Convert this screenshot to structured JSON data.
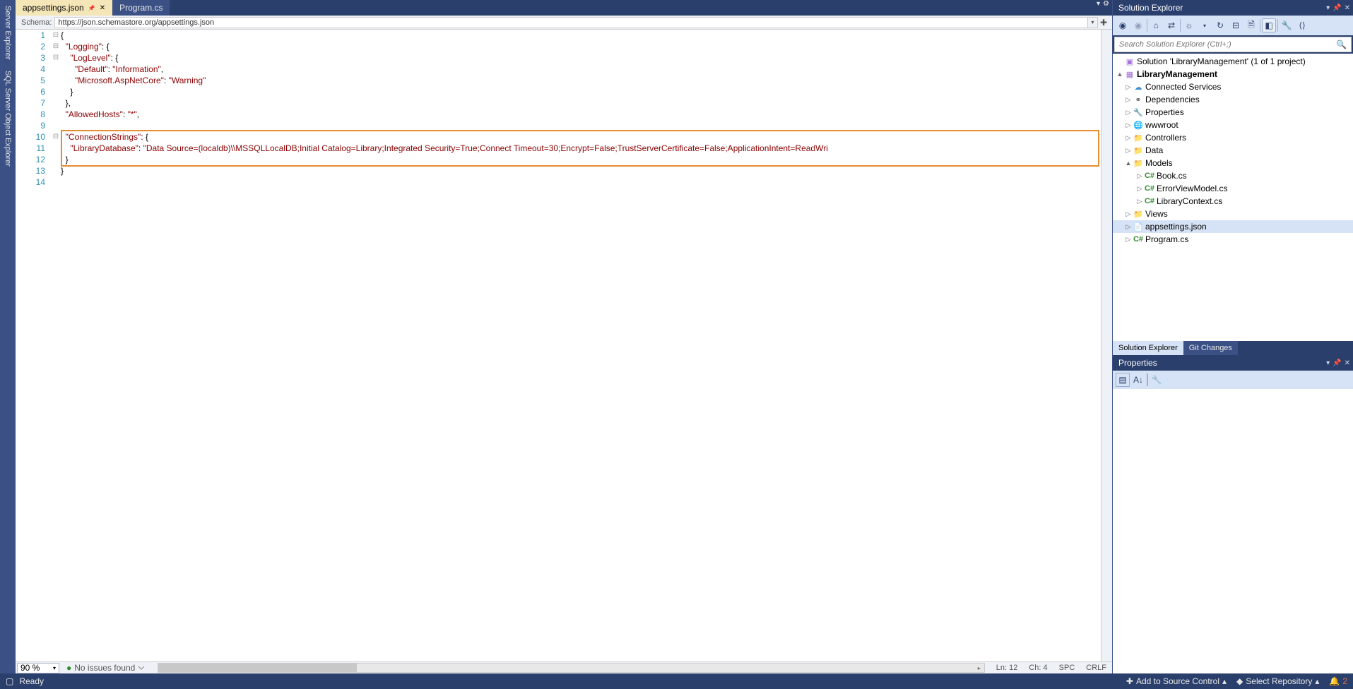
{
  "left_sidebar": {
    "tabs": [
      "Server Explorer",
      "SQL Server Object Explorer"
    ]
  },
  "editor": {
    "tabs": [
      {
        "label": "appsettings.json",
        "active": true
      },
      {
        "label": "Program.cs",
        "active": false
      }
    ],
    "schema_label": "Schema:",
    "schema_url": "https://json.schemastore.org/appsettings.json",
    "code": {
      "lines": [
        {
          "n": 1,
          "fold": "⊟",
          "segments": [
            {
              "t": "{",
              "c": "p"
            }
          ]
        },
        {
          "n": 2,
          "fold": "⊟",
          "segments": [
            {
              "t": "  ",
              "c": "p"
            },
            {
              "t": "\"Logging\"",
              "c": "k"
            },
            {
              "t": ": {",
              "c": "p"
            }
          ]
        },
        {
          "n": 3,
          "fold": "⊟",
          "segments": [
            {
              "t": "    ",
              "c": "p"
            },
            {
              "t": "\"LogLevel\"",
              "c": "k"
            },
            {
              "t": ": {",
              "c": "p"
            }
          ]
        },
        {
          "n": 4,
          "fold": "",
          "segments": [
            {
              "t": "      ",
              "c": "p"
            },
            {
              "t": "\"Default\"",
              "c": "k"
            },
            {
              "t": ": ",
              "c": "p"
            },
            {
              "t": "\"Information\"",
              "c": "v"
            },
            {
              "t": ",",
              "c": "p"
            }
          ]
        },
        {
          "n": 5,
          "fold": "",
          "segments": [
            {
              "t": "      ",
              "c": "p"
            },
            {
              "t": "\"Microsoft.AspNetCore\"",
              "c": "k"
            },
            {
              "t": ": ",
              "c": "p"
            },
            {
              "t": "\"Warning\"",
              "c": "v"
            }
          ]
        },
        {
          "n": 6,
          "fold": "",
          "segments": [
            {
              "t": "    }",
              "c": "p"
            }
          ]
        },
        {
          "n": 7,
          "fold": "",
          "segments": [
            {
              "t": "  },",
              "c": "p"
            }
          ]
        },
        {
          "n": 8,
          "fold": "",
          "segments": [
            {
              "t": "  ",
              "c": "p"
            },
            {
              "t": "\"AllowedHosts\"",
              "c": "k"
            },
            {
              "t": ": ",
              "c": "p"
            },
            {
              "t": "\"*\"",
              "c": "v"
            },
            {
              "t": ",",
              "c": "p"
            }
          ]
        },
        {
          "n": 9,
          "fold": "",
          "segments": [
            {
              "t": "",
              "c": "p"
            }
          ]
        },
        {
          "n": 10,
          "fold": "⊟",
          "segments": [
            {
              "t": "  ",
              "c": "p"
            },
            {
              "t": "\"ConnectionStrings\"",
              "c": "k"
            },
            {
              "t": ": {",
              "c": "p"
            }
          ]
        },
        {
          "n": 11,
          "fold": "",
          "segments": [
            {
              "t": "    ",
              "c": "p"
            },
            {
              "t": "\"LibraryDatabase\"",
              "c": "k"
            },
            {
              "t": ": ",
              "c": "p"
            },
            {
              "t": "\"Data Source=(localdb)\\\\MSSQLLocalDB;Initial Catalog=Library;Integrated Security=True;Connect Timeout=30;Encrypt=False;TrustServerCertificate=False;ApplicationIntent=ReadWri",
              "c": "v"
            }
          ]
        },
        {
          "n": 12,
          "fold": "",
          "segments": [
            {
              "t": "  }",
              "c": "p"
            }
          ]
        },
        {
          "n": 13,
          "fold": "",
          "segments": [
            {
              "t": "}",
              "c": "p"
            }
          ]
        },
        {
          "n": 14,
          "fold": "",
          "segments": [
            {
              "t": "",
              "c": "p"
            }
          ]
        }
      ],
      "highlight": {
        "startLine": 10,
        "endLine": 12
      }
    },
    "zoom": "90 %",
    "issues": "No issues found",
    "cursor": {
      "line": "Ln: 12",
      "col": "Ch: 4",
      "ins": "SPC",
      "eol": "CRLF"
    }
  },
  "solution_explorer": {
    "title": "Solution Explorer",
    "search_placeholder": "Search Solution Explorer (Ctrl+;)",
    "tree": [
      {
        "depth": 0,
        "exp": "",
        "icon": "sln",
        "label": "Solution 'LibraryManagement' (1 of 1 project)"
      },
      {
        "depth": 0,
        "exp": "▲",
        "icon": "proj",
        "label": "LibraryManagement",
        "bold": true
      },
      {
        "depth": 1,
        "exp": "▷",
        "icon": "cloud",
        "label": "Connected Services"
      },
      {
        "depth": 1,
        "exp": "▷",
        "icon": "dep",
        "label": "Dependencies"
      },
      {
        "depth": 1,
        "exp": "▷",
        "icon": "wrench",
        "label": "Properties"
      },
      {
        "depth": 1,
        "exp": "▷",
        "icon": "globe",
        "label": "wwwroot"
      },
      {
        "depth": 1,
        "exp": "▷",
        "icon": "folder",
        "label": "Controllers"
      },
      {
        "depth": 1,
        "exp": "▷",
        "icon": "folder",
        "label": "Data"
      },
      {
        "depth": 1,
        "exp": "▲",
        "icon": "folder",
        "label": "Models"
      },
      {
        "depth": 2,
        "exp": "▷",
        "icon": "cs",
        "label": "Book.cs"
      },
      {
        "depth": 2,
        "exp": "▷",
        "icon": "cs",
        "label": "ErrorViewModel.cs"
      },
      {
        "depth": 2,
        "exp": "▷",
        "icon": "cs",
        "label": "LibraryContext.cs"
      },
      {
        "depth": 1,
        "exp": "▷",
        "icon": "folder",
        "label": "Views"
      },
      {
        "depth": 1,
        "exp": "▷",
        "icon": "json",
        "label": "appsettings.json",
        "selected": true
      },
      {
        "depth": 1,
        "exp": "▷",
        "icon": "cs",
        "label": "Program.cs"
      }
    ],
    "bottom_tabs": [
      "Solution Explorer",
      "Git Changes"
    ]
  },
  "properties": {
    "title": "Properties"
  },
  "status": {
    "ready": "Ready",
    "add_source": "Add to Source Control",
    "select_repo": "Select Repository",
    "bell_count": "2"
  }
}
